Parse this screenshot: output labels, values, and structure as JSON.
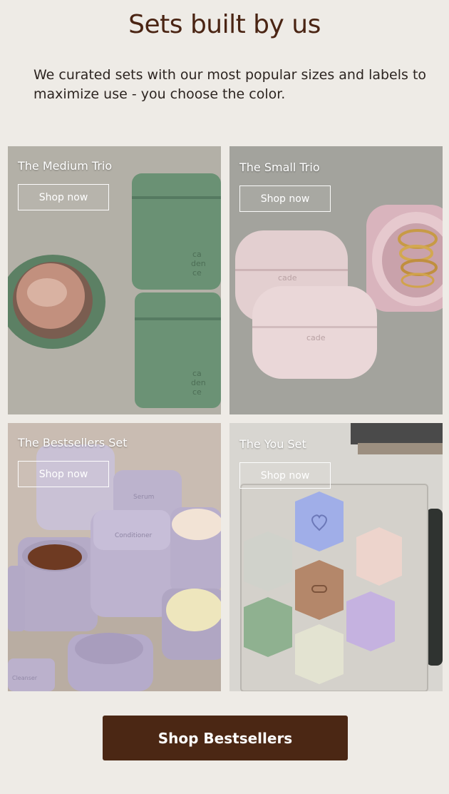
{
  "heading": "Sets built by us",
  "subtitle": "We curated sets with our most popular sizes and labels to maximize use - you choose the color.",
  "cards": [
    {
      "title": "The Medium Trio",
      "button": "Shop now"
    },
    {
      "title": "The Small Trio",
      "button": "Shop now"
    },
    {
      "title": "The Bestsellers Set",
      "button": "Shop now"
    },
    {
      "title": "The You Set",
      "button": "Shop now"
    }
  ],
  "cta": "Shop Bestsellers",
  "colors": {
    "background": "#eeebe6",
    "heading": "#4a2413",
    "cta_bg": "#4b2714"
  }
}
